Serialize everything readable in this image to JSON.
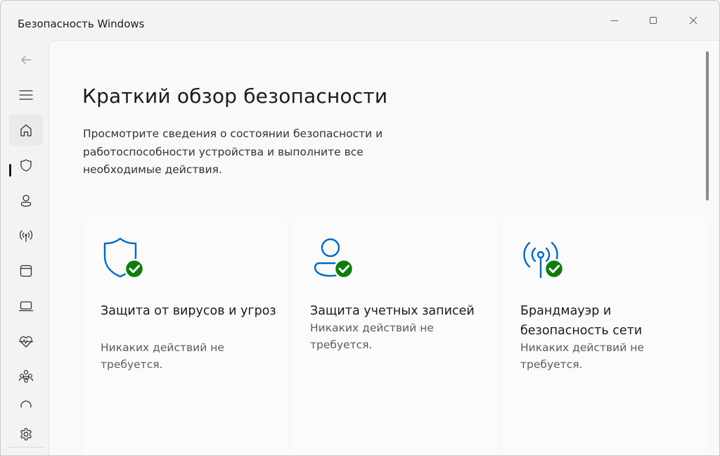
{
  "window": {
    "title": "Безопасность Windows"
  },
  "nav": {
    "items": [
      {
        "icon": "back-arrow-icon"
      },
      {
        "icon": "hamburger-menu-icon"
      },
      {
        "icon": "home-icon",
        "active": true
      },
      {
        "icon": "shield-icon"
      },
      {
        "icon": "person-icon"
      },
      {
        "icon": "wireless-antenna-icon"
      },
      {
        "icon": "app-browser-icon"
      },
      {
        "icon": "laptop-icon"
      },
      {
        "icon": "heart-pulse-icon"
      },
      {
        "icon": "family-icon"
      },
      {
        "icon": "settings-gear-icon"
      }
    ]
  },
  "main": {
    "title": "Краткий обзор безопасности",
    "description": "Просмотрите сведения о состоянии безопасности и работоспособности устройства и выполните все необходимые действия.",
    "cards": [
      {
        "icon": "virus-protection-shield-icon",
        "title": "Защита от вирусов и угроз",
        "status": "Никаких действий не требуется."
      },
      {
        "icon": "account-protection-person-icon",
        "title": "Защита учетных записей",
        "status": "Никаких действий не требуется."
      },
      {
        "icon": "firewall-network-antenna-icon",
        "title": "Брандмауэр и безопасность сети",
        "status": "Никаких действий не требуется."
      }
    ]
  },
  "colors": {
    "accent_blue": "#0067c0",
    "ok_green": "#107c10",
    "background": "#f3f3f3",
    "content_background": "#f9f9f9"
  }
}
